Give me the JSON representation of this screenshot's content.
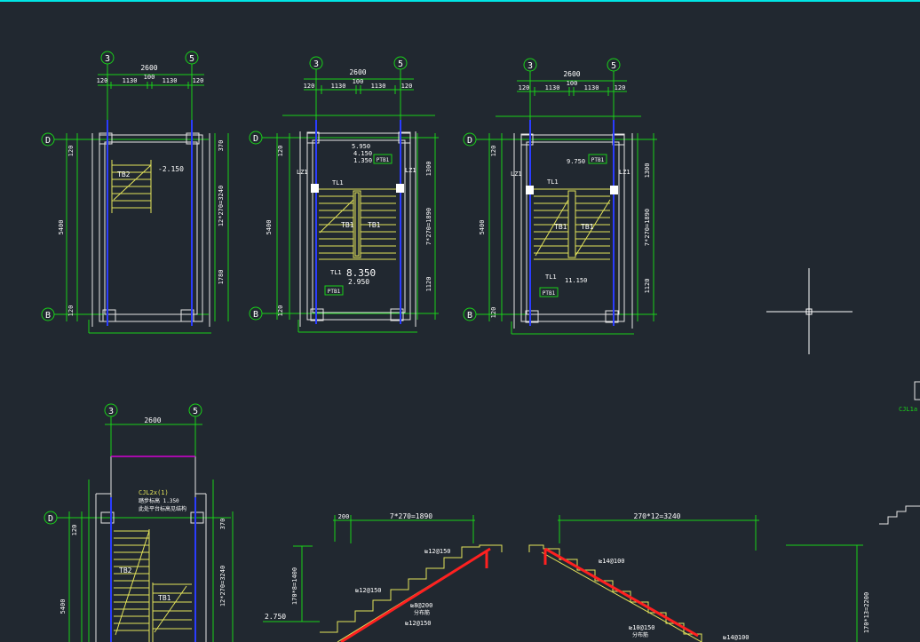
{
  "theme": {
    "background": "#212830",
    "top_border": "#00e5e5",
    "dim_line": "#19d119",
    "wall": "#e6e6e6",
    "column": "#2a3cff",
    "stair": "#e3e35a",
    "rebar": "#ff2020",
    "label": "#ffffff",
    "lintel": "#d400d4",
    "crosshair": "#ffffff"
  },
  "axes": {
    "col_left": "3",
    "col_right": "5",
    "row_top": "D",
    "row_bottom": "B"
  },
  "dims": {
    "total_width": "2600",
    "w120": "120",
    "w1130": "1130",
    "w100": "100",
    "height_total": "5400",
    "h120": "120",
    "h370": "370",
    "h1780": "1780",
    "h1300": "1300",
    "h1120": "1120",
    "stair_run_a": "12*270=3240",
    "stair_run_b": "7*270=1890",
    "stair_run_c": "270*12=3240",
    "stair_rise_a": "170*13=2200",
    "stair_rise_b": "170*8=1400",
    "h200": "200"
  },
  "labels": {
    "tb2": "TB2",
    "tb1": "TB1",
    "tl1": "TL1",
    "lz1": "LZ1",
    "ptb1": "PTB1",
    "elev_m2150": "-2.150",
    "elev_5950": "5.950",
    "elev_4150": "4.150",
    "elev_1350": "1.350",
    "elev_8350": "8.350",
    "elev_2950": "2.950",
    "elev_9750": "9.750",
    "elev_11150": "11.150",
    "elev_2750": "2.750",
    "note_cjl": "CJL2x(1)",
    "note_line2": "踏步标高 1.350",
    "note_line3": "此处平台标高见结构",
    "rebar_12_150": "⊵12@150",
    "rebar_8_200": "⊵8@200",
    "rebar_14_100": "⊵14@100",
    "rebar_10_150": "⊵10@150",
    "rebar_14_100b": "⊵14@100",
    "rebar_note": "分布筋",
    "side_tag": "CJL1a"
  }
}
